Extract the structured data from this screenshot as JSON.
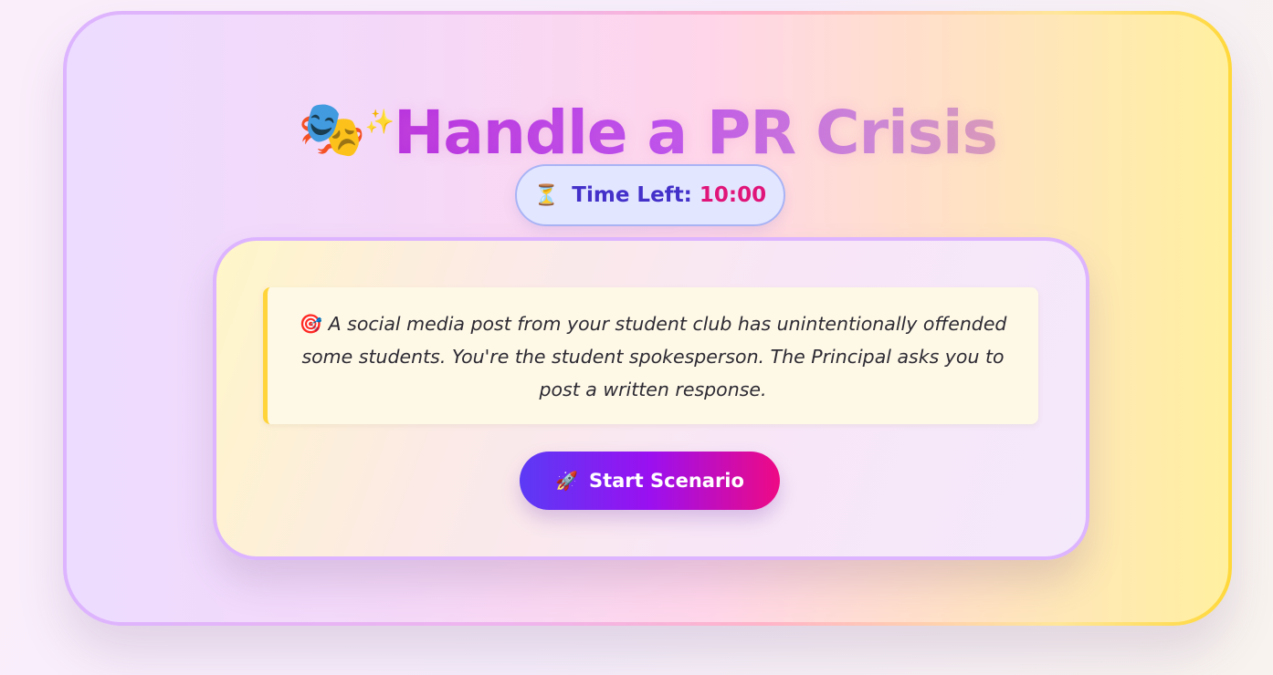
{
  "title": {
    "icon": "performing-arts-icon",
    "icon_glyph": "🎭",
    "sparkle_icon": "sparkles-icon",
    "sparkle_glyph": "✨",
    "text": "Handle a PR Crisis",
    "gradient_colors": [
      "#b52ee0",
      "#b84ef0",
      "#c98ad8",
      "#d7a0b8"
    ]
  },
  "timer": {
    "icon": "hourglass-icon",
    "icon_glyph": "⏳",
    "label": "Time Left:",
    "value": "10:00",
    "label_color": "#4331c9",
    "value_color": "#e0157a"
  },
  "scenario": {
    "icon": "target-icon",
    "icon_glyph": "🎯",
    "text": "A social media post from your student club has unintentionally offended some students. You're the student spokesperson. The Principal asks you to post a written response."
  },
  "start_button": {
    "icon": "rocket-icon",
    "icon_glyph": "🚀",
    "label": "Start Scenario",
    "gradient_colors": [
      "#5b3af5",
      "#9a10f0",
      "#ee0a84"
    ]
  },
  "colors": {
    "accent_border": "#dcb4ff",
    "scenario_border": "#ffd43b",
    "timer_background": "#e3e6ff"
  }
}
